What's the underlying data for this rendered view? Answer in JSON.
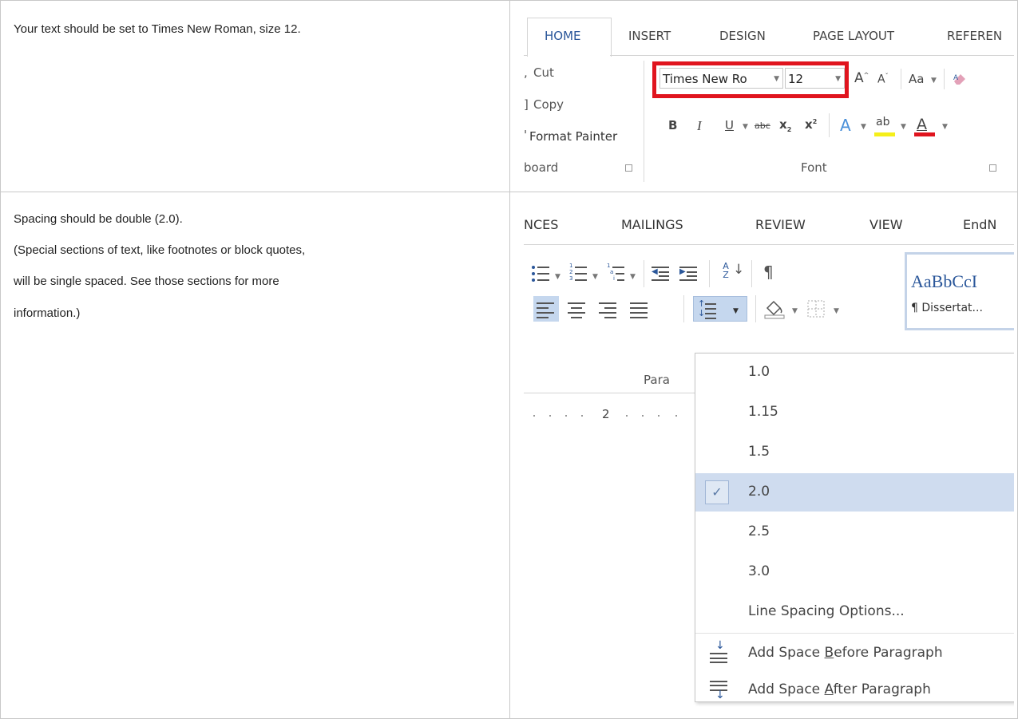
{
  "instructions": {
    "row1_text": "Your text should be set to Times New Roman, size 12.",
    "row2_lines": [
      "Spacing should be double (2.0).",
      "(Special sections of text, like footnotes or block quotes,",
      "will be single spaced. See those sections for more",
      "information.)"
    ]
  },
  "font_ribbon": {
    "tabs": [
      "HOME",
      "INSERT",
      "DESIGN",
      "PAGE LAYOUT",
      "REFEREN"
    ],
    "active_tab": "HOME",
    "clipboard": {
      "cut": "Cut",
      "copy": "Copy",
      "format_painter": "Format Painter",
      "group_label": "board"
    },
    "font": {
      "font_name": "Times New Ro",
      "font_size": "12",
      "grow_font": "A",
      "shrink_font": "A",
      "change_case": "Aa",
      "bold": "B",
      "italic": "I",
      "underline": "U",
      "strikethrough": "abc",
      "subscript": "x",
      "superscript": "x",
      "text_effects": "A",
      "highlight": "ab",
      "font_color": "A",
      "group_label": "Font"
    },
    "highlight_color": "#e0141e"
  },
  "paragraph_ribbon": {
    "tabs": [
      "NCES",
      "MAILINGS",
      "REVIEW",
      "VIEW",
      "EndN"
    ],
    "sort_label": "A Z",
    "pilcrow": "¶",
    "style_preview": "AaBbCcI",
    "style_name": "¶ Dissertat...",
    "group_label": "Para",
    "ruler_mark": "2",
    "line_spacing_menu": {
      "options": [
        "1.0",
        "1.15",
        "1.5",
        "2.0",
        "2.5",
        "3.0"
      ],
      "selected": "2.0",
      "line_spacing_options": "Line Spacing Options...",
      "add_before_prefix": "Add Space ",
      "add_before_key": "B",
      "add_before_suffix": "efore Paragraph",
      "add_after_prefix": "Add Space ",
      "add_after_key": "A",
      "add_after_suffix": "fter Paragraph"
    }
  }
}
